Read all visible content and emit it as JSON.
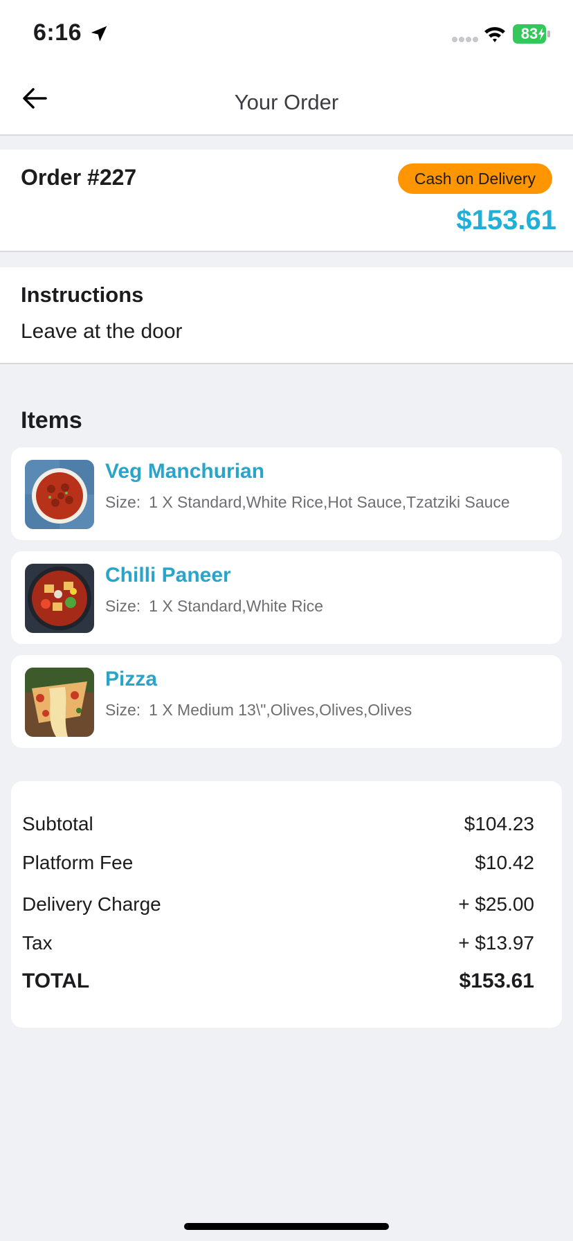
{
  "status_bar": {
    "time": "6:16",
    "battery": "83",
    "icons": [
      "location-arrow-icon",
      "signal-icon",
      "wifi-icon",
      "battery-charging-icon"
    ]
  },
  "nav": {
    "title": "Your Order",
    "back_icon": "arrow-left-icon"
  },
  "order": {
    "number": "Order #227",
    "payment_method": "Cash on Delivery",
    "total": "$153.61",
    "accent_color": "#1eb0d8",
    "badge_color": "#ff9500"
  },
  "instructions": {
    "heading": "Instructions",
    "text": "Leave at the door"
  },
  "items": {
    "heading": "Items",
    "list": [
      {
        "name": "Veg Manchurian",
        "size_label": "Size:",
        "size": "1 X Standard,White Rice,Hot Sauce,Tzatziki Sauce",
        "image": "veg-manchurian-photo"
      },
      {
        "name": "Chilli Paneer",
        "size_label": "Size:",
        "size": "1 X Standard,White Rice",
        "image": "chilli-paneer-photo"
      },
      {
        "name": "Pizza",
        "size_label": "Size:",
        "size": "1 X Medium 13\\\",Olives,Olives,Olives",
        "image": "pizza-photo"
      }
    ]
  },
  "summary": {
    "rows": [
      {
        "label": "Subtotal",
        "value": "$104.23"
      },
      {
        "label": "Platform Fee",
        "value": "$10.42"
      },
      {
        "label": "Delivery Charge",
        "value": "+ $25.00"
      },
      {
        "label": "Tax",
        "value": "+ $13.97"
      }
    ],
    "total_label": "TOTAL",
    "total_value": "$153.61"
  }
}
